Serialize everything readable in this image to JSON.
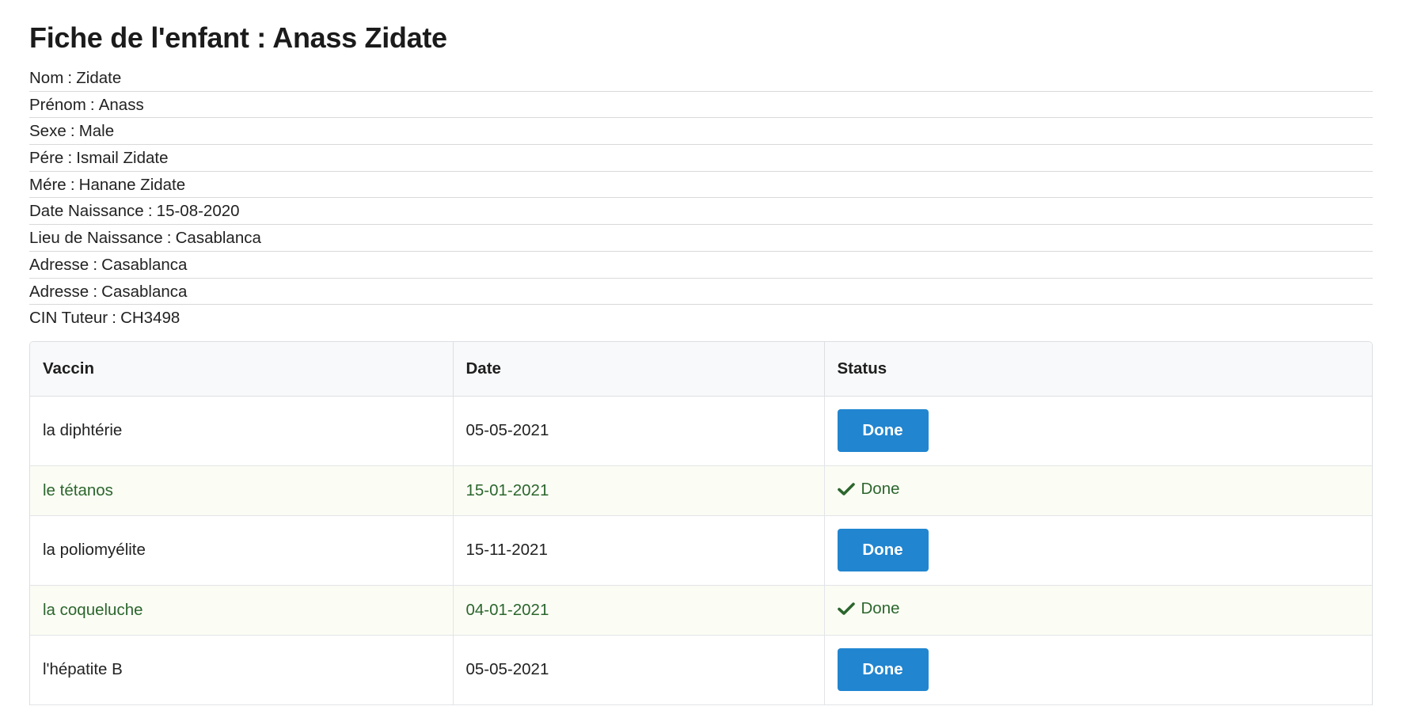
{
  "page": {
    "title": "Fiche de l'enfant : Anass Zidate"
  },
  "info": [
    {
      "label": "Nom",
      "value": "Zidate"
    },
    {
      "label": "Prénom",
      "value": "Anass"
    },
    {
      "label": "Sexe",
      "value": "Male"
    },
    {
      "label": "Pére",
      "value": "Ismail Zidate"
    },
    {
      "label": "Mére",
      "value": "Hanane Zidate"
    },
    {
      "label": "Date Naissance",
      "value": "15-08-2020"
    },
    {
      "label": "Lieu de Naissance",
      "value": "Casablanca"
    },
    {
      "label": "Adresse",
      "value": "Casablanca"
    },
    {
      "label": "Adresse",
      "value": "Casablanca"
    },
    {
      "label": "CIN Tuteur",
      "value": "CH3498"
    }
  ],
  "table": {
    "headers": [
      "Vaccin",
      "Date",
      "Status"
    ],
    "rows": [
      {
        "vaccin": "la diphtérie",
        "date": "05-05-2021",
        "status": "Done",
        "completed": false
      },
      {
        "vaccin": "le tétanos",
        "date": "15-01-2021",
        "status": "Done",
        "completed": true
      },
      {
        "vaccin": "la poliomyélite",
        "date": "15-11-2021",
        "status": "Done",
        "completed": false
      },
      {
        "vaccin": "la coqueluche",
        "date": "04-01-2021",
        "status": "Done",
        "completed": true
      },
      {
        "vaccin": "l'hépatite B",
        "date": "05-05-2021",
        "status": "Done",
        "completed": false
      }
    ]
  },
  "colors": {
    "button_primary": "#2185d0",
    "done_text": "#2c662d",
    "done_row_bg": "#fbfdf5"
  },
  "icons": {
    "completed": "checkmark-icon"
  }
}
